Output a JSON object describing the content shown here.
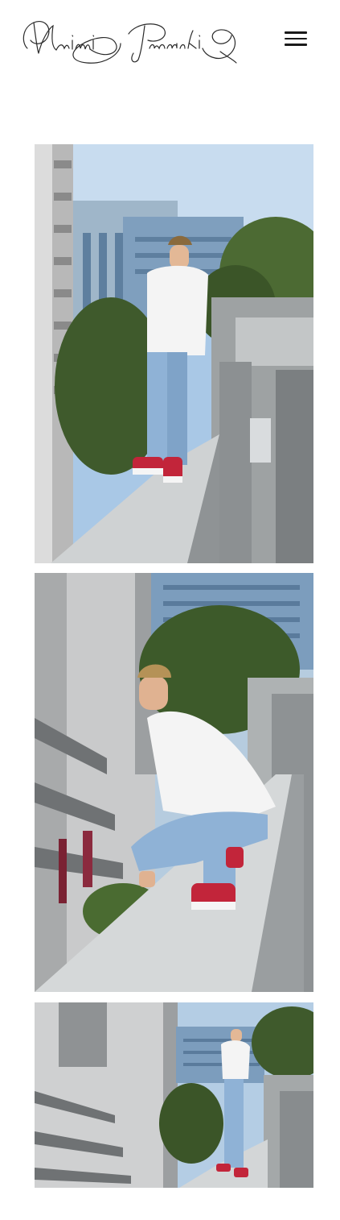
{
  "header": {
    "logo_text": "Naimi Terasaki",
    "logo_icon": "signature-logo",
    "menu_icon": "hamburger-menu-icon"
  },
  "gallery": {
    "photos": [
      {
        "description_icon": "photo-standing-on-ledge"
      },
      {
        "description_icon": "photo-crouching-on-ledge"
      },
      {
        "description_icon": "photo-standing-wide-shot"
      }
    ]
  },
  "colors": {
    "background": "#ffffff",
    "menu_bar": "#1a1a1a",
    "sky": "#a9c8e6",
    "concrete": "#b9bcbd",
    "foliage": "#3f5a2c",
    "shirt": "#f4f4f4",
    "jeans": "#8fb2d6",
    "sneaker_red": "#c2253a"
  }
}
